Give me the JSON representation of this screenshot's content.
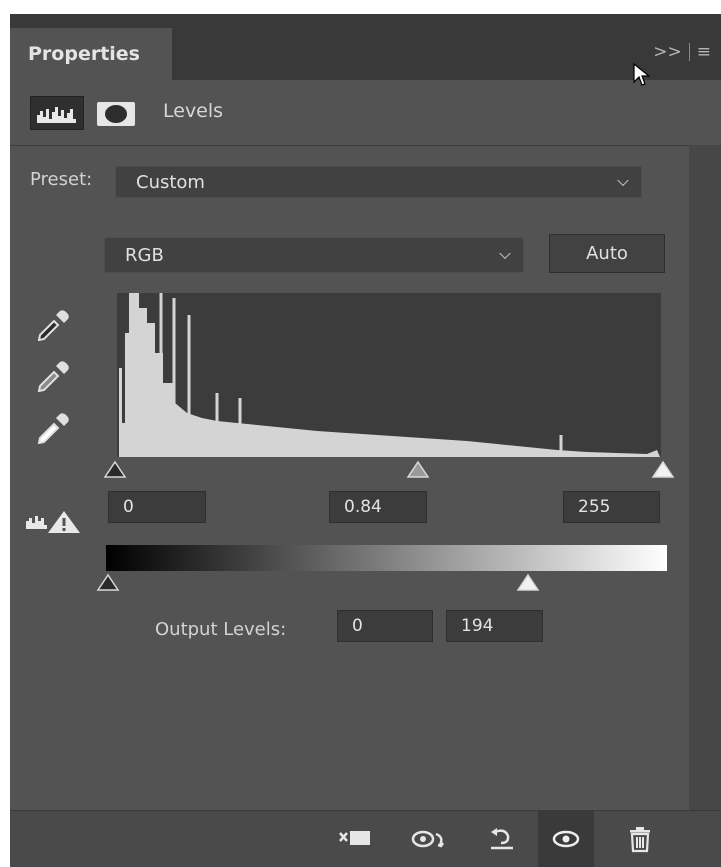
{
  "panel": {
    "tab_title": "Properties",
    "tab_tools": {
      "expand": ">>",
      "menu": "≡"
    }
  },
  "header": {
    "icons": [
      "histogram-icon",
      "mask-icon"
    ],
    "title": "Levels"
  },
  "preset": {
    "label": "Preset:",
    "value": "Custom"
  },
  "channel": {
    "value": "RGB",
    "auto_label": "Auto"
  },
  "eyedroppers": [
    "black-point-eyedropper-icon",
    "gray-point-eyedropper-icon",
    "white-point-eyedropper-icon"
  ],
  "input_levels": {
    "black": "0",
    "midtone": "0.84",
    "white": "255"
  },
  "output_levels": {
    "label": "Output Levels:",
    "black": "0",
    "white": "194"
  },
  "footer_icons": [
    "clip-to-layer-icon",
    "view-previous-state-icon",
    "reset-icon",
    "visibility-icon",
    "delete-icon"
  ],
  "colors": {
    "panel_bg": "#535353",
    "tab_bar_bg": "#393939",
    "field_bg": "#3c3c3c",
    "histogram_fill": "#d4d4d4"
  }
}
